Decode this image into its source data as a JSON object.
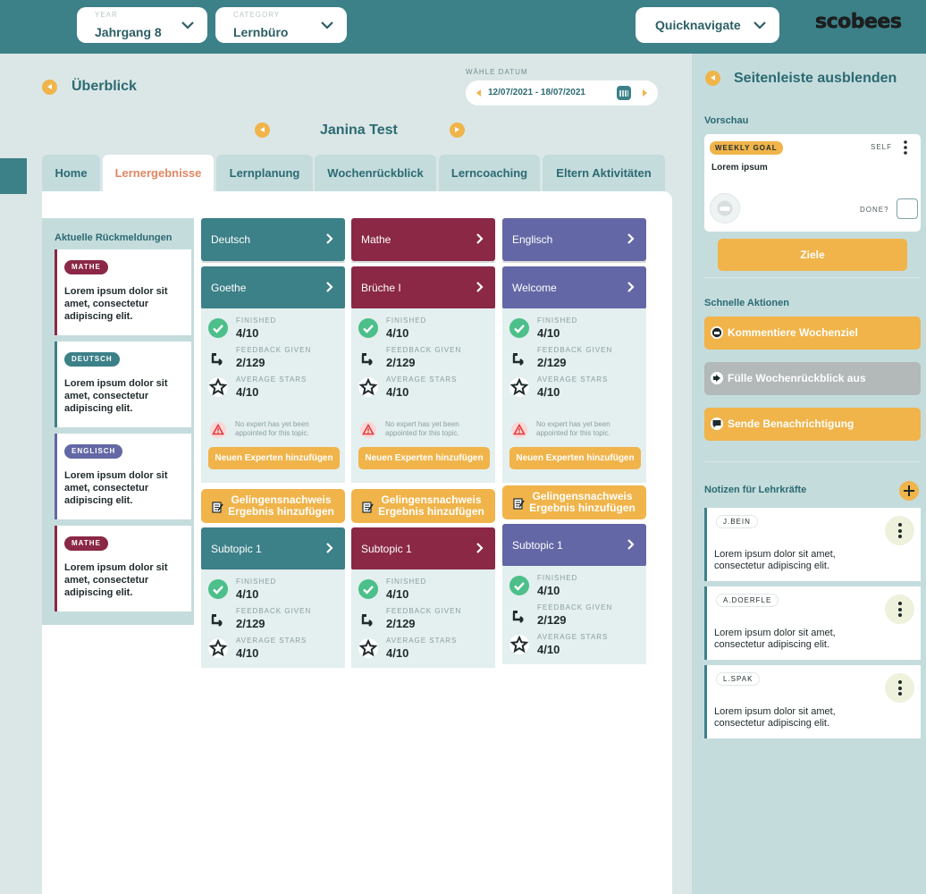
{
  "topbar": {
    "year": {
      "label": "YEAR",
      "value": "Jahrgang 8"
    },
    "category": {
      "label": "CATEGORY",
      "value": "Lernbüro"
    },
    "quicknav": "Quicknavigate",
    "logo": "scobees"
  },
  "overview": {
    "title": "Überblick"
  },
  "date": {
    "label": "WÄHLE DATUM",
    "range": "12/07/2021 - 18/07/2021"
  },
  "student": "Janina Test",
  "tabs": [
    "Home",
    "Lernergebnisse",
    "Lernplanung",
    "Wochenrückblick",
    "Lerncoaching",
    "Eltern Aktivitäten"
  ],
  "active_tab": "Lernergebnisse",
  "feedback": {
    "title": "Aktuelle Rückmeldungen",
    "items": [
      {
        "badge": "MATHE",
        "text": "Lorem ipsum dolor sit amet, consectetur adipiscing elit.",
        "color": "#8a2846"
      },
      {
        "badge": "DEUTSCH",
        "text": "Lorem ipsum dolor sit amet, consectetur adipiscing elit.",
        "color": "#3c8088"
      },
      {
        "badge": "ENGLISCH",
        "text": "Lorem ipsum dolor sit amet, consectetur adipiscing elit.",
        "color": "#6367a5"
      },
      {
        "badge": "MATHE",
        "text": "Lorem ipsum dolor sit amet, consectetur adipiscing elit.",
        "color": "#8a2846"
      }
    ]
  },
  "stat_labels": {
    "finished": "FINISHED",
    "feedback": "FEEDBACK GIVEN",
    "stars": "AVERAGE STARS"
  },
  "warning": "No expert has yet been appointed for this topic.",
  "add_expert": "Neuen Experten hinzufügen",
  "proof": {
    "line1": "Gelingensnachweis",
    "line2": "Ergebnis hinzufügen"
  },
  "subjects": [
    {
      "name": "Deutsch",
      "topic": "Goethe",
      "color": "#3c8088",
      "stats": {
        "finished": "4/10",
        "feedback": "2/129",
        "stars": "4/10"
      },
      "subtopic": "Subtopic 1",
      "sub_stats": {
        "finished": "4/10",
        "feedback": "2/129",
        "stars": "4/10"
      }
    },
    {
      "name": "Mathe",
      "topic": "Brüche I",
      "color": "#8a2846",
      "stats": {
        "finished": "4/10",
        "feedback": "2/129",
        "stars": "4/10"
      },
      "subtopic": "Subtopic 1",
      "sub_stats": {
        "finished": "4/10",
        "feedback": "2/129",
        "stars": "4/10"
      }
    },
    {
      "name": "Englisch",
      "topic": "Welcome",
      "color": "#6367a5",
      "stats": {
        "finished": "4/10",
        "feedback": "2/129",
        "stars": "4/10"
      },
      "subtopic": "Subtopic 1",
      "sub_stats": {
        "finished": "4/10",
        "feedback": "2/129",
        "stars": "4/10"
      }
    }
  ],
  "sidebar": {
    "hide": "Seitenleiste ausblenden",
    "preview": "Vorschau",
    "goal": {
      "badge": "WEEKLY GOAL",
      "owner": "SELF",
      "text": "Lorem ipsum",
      "done": "DONE?"
    },
    "goals_button": "Ziele",
    "quick_actions_title": "Schnelle Aktionen",
    "quick_actions": [
      {
        "label": "Kommentiere Wochenziel",
        "color": "#f0b44a"
      },
      {
        "label": "Fülle Wochenrückblick aus",
        "color": "#b3b8b8"
      },
      {
        "label": "Sende Benachrichtigung",
        "color": "#f0b44a"
      }
    ],
    "notes_title": "Notizen für Lehrkräfte",
    "notes": [
      {
        "author": "J.BEIN",
        "text": "Lorem ipsum dolor sit amet, consectetur adipiscing elit."
      },
      {
        "author": "A.DOERFLE",
        "text": "Lorem ipsum dolor sit amet, consectetur adipiscing elit."
      },
      {
        "author": "L.SPAK",
        "text": "Lorem ipsum dolor sit amet, consectetur adipiscing elit."
      }
    ]
  }
}
